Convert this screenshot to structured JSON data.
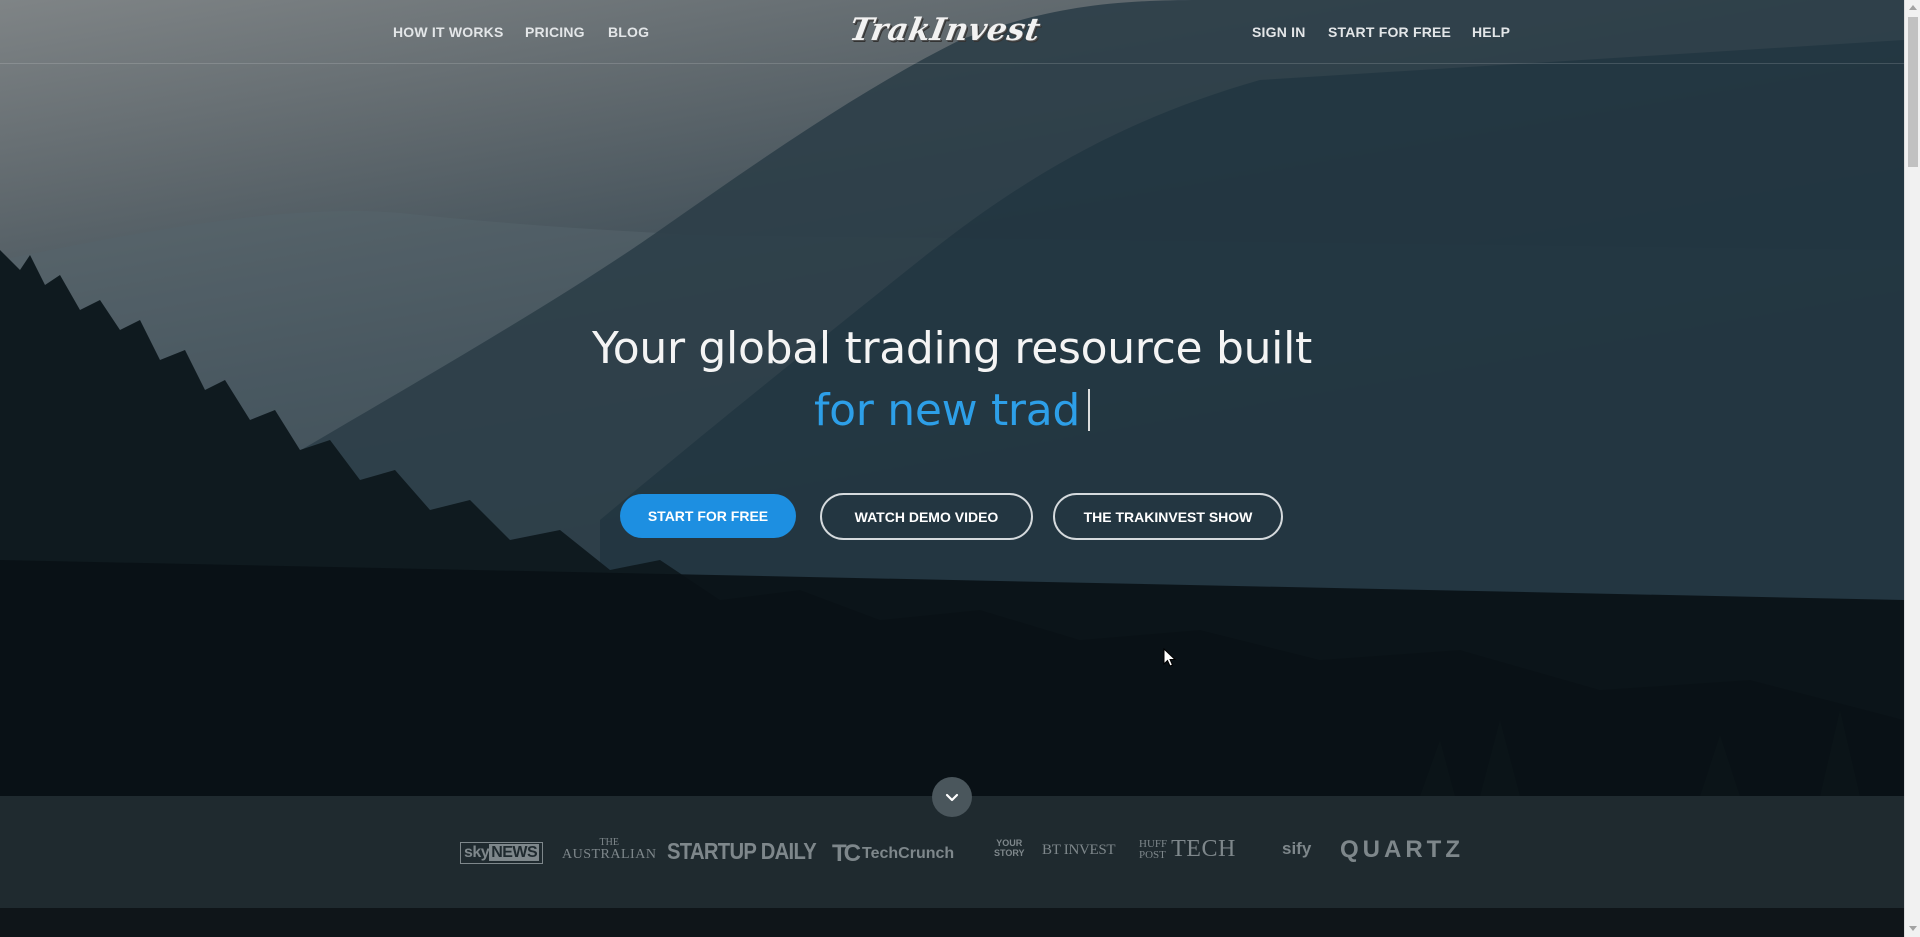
{
  "nav": {
    "left": [
      "HOW IT WORKS",
      "PRICING",
      "BLOG"
    ],
    "logo": "TrakInvest",
    "right": [
      "SIGN IN",
      "START FOR FREE",
      "HELP"
    ]
  },
  "hero": {
    "line1": "Your global trading resource built",
    "line2": "for new trad",
    "buttons": {
      "primary": "START FOR FREE",
      "demo": "WATCH DEMO VIDEO",
      "show": "THE TRAKINVEST SHOW"
    }
  },
  "press": {
    "sky_a": "sky",
    "sky_b": "NEWS",
    "australian_a": "THE",
    "australian_b": "AUSTRALIAN",
    "startup": "STARTUP DAILY",
    "techcrunch": "TechCrunch",
    "yourstory_a": "YOUR",
    "yourstory_b": "STORY",
    "btinvest": "BT INVEST",
    "huff_a": "HUFF",
    "huff_b": "POST",
    "huff_c": "TECH",
    "sify": "sify",
    "quartz": "QUARTZ"
  },
  "colors": {
    "accent": "#1d8fe1",
    "headline_accent": "#2d9fe8"
  },
  "icons": {
    "scroll_down": "chevron-down-icon",
    "mouse": "mouse-pointer-icon"
  }
}
